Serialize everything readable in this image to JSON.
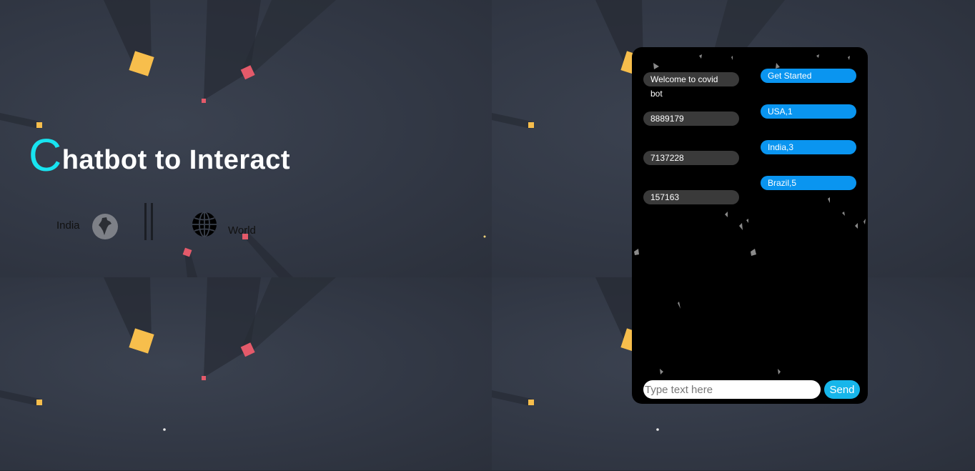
{
  "hero": {
    "title_first_letter": "C",
    "title_rest": "hatbot to Interact"
  },
  "nav": {
    "india_label": "India",
    "india_icon": "india-map-icon",
    "world_label": "World",
    "world_icon": "globe-icon"
  },
  "chat": {
    "bot_messages": [
      "Welcome to covid bot",
      "8889179",
      "7137228",
      "157163"
    ],
    "user_messages": [
      "Get Started",
      "USA,1",
      "India,3",
      "Brazil,5"
    ],
    "input_placeholder": "Type text here",
    "send_label": "Send"
  },
  "colors": {
    "accent_cyan": "#18e4f0",
    "user_bubble": "#0a95f0",
    "bot_bubble": "#3a3a3a",
    "send_button": "#17b6ea",
    "chat_background": "#000000"
  }
}
